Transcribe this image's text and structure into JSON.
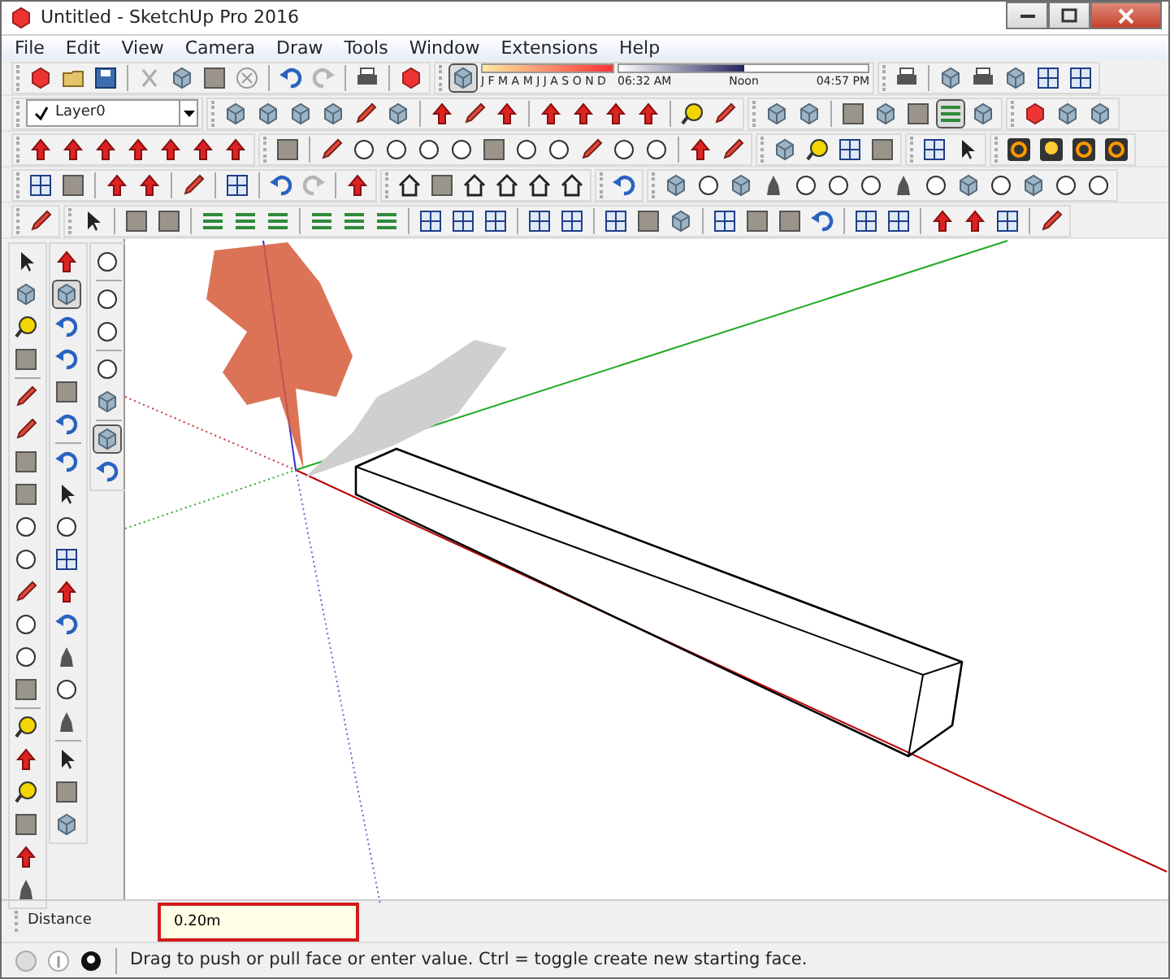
{
  "window": {
    "title": "Untitled - SketchUp Pro 2016"
  },
  "menu": [
    "File",
    "Edit",
    "View",
    "Camera",
    "Draw",
    "Tools",
    "Window",
    "Extensions",
    "Help"
  ],
  "shadows": {
    "toggle": {
      "selected": true
    },
    "months": "J F M A M J J A S O N D",
    "month_slider": {
      "level": 1
    },
    "time_slider": {
      "level": 0.5
    },
    "times": [
      "06:32 AM",
      "Noon",
      "04:57 PM"
    ]
  },
  "layer": {
    "name": "Layer0",
    "current": true
  },
  "styles_buttons": [
    {
      "selected": false
    },
    {
      "selected": false
    },
    {
      "selected": false
    },
    {
      "selected": false
    },
    {
      "selected": false
    },
    {
      "selected": true
    },
    {
      "selected": false
    }
  ],
  "left_tools": [
    {
      "selected": false
    },
    {
      "selected": true
    },
    {
      "selected": false
    },
    {
      "selected": false
    },
    {
      "selected": false
    },
    {
      "selected": false
    }
  ],
  "face_tools": [
    {
      "selected": false
    },
    {
      "selected": false
    },
    {
      "selected": false
    },
    {
      "selected": false
    },
    {
      "selected": false
    },
    {
      "selected": true
    },
    {
      "selected": false
    }
  ],
  "measurements": {
    "label": "Distance",
    "value": "0.20m"
  },
  "status_bar": {
    "text": "Drag to push or pull face or enter value.  Ctrl = toggle create new starting face."
  }
}
